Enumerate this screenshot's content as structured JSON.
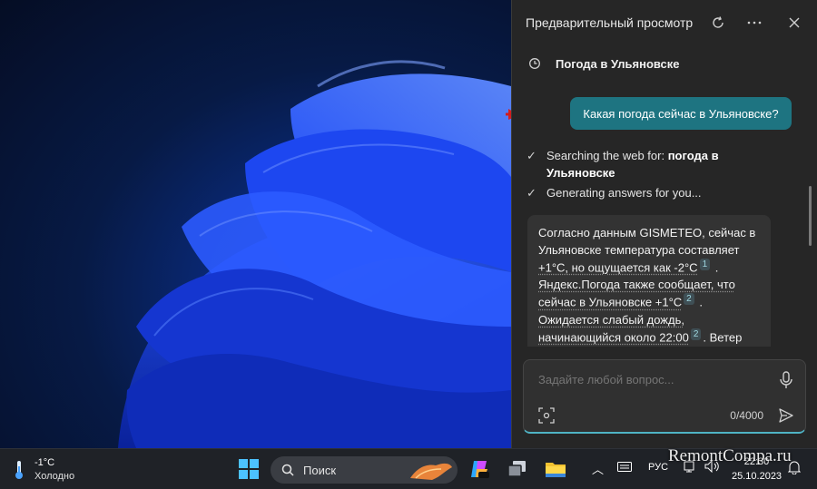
{
  "panel": {
    "title": "Предварительный просмотр",
    "conversation_title": "Погода в Ульяновске",
    "user_message": "Какая погода сейчас в Ульяновске?",
    "steps": [
      {
        "prefix": "Searching the web for: ",
        "bold": "погода в Ульяновске"
      },
      {
        "prefix": "Generating answers for you...",
        "bold": ""
      }
    ],
    "answer": {
      "line1": "Согласно данным GISMETEO, сейчас в",
      "line2": "Ульяновске температура составляет",
      "line3": "+1°C, но ощущается как -2°C",
      "cite1": "1",
      "line4": "Яндекс.Погода также сообщает, что",
      "line5": "сейчас в Ульяновске +1°C",
      "cite2": "2",
      "line6": "Ожидается слабый дождь,",
      "line7": "начинающийся около 22:00",
      "cite3": "2",
      "line7_tail": ". Ветер"
    },
    "input": {
      "placeholder": "Задайте любой вопрос...",
      "counter": "0/4000"
    },
    "accent_color": "#1e7481"
  },
  "taskbar": {
    "weather_temp": "-1°C",
    "weather_desc": "Холодно",
    "search_label": "Поиск",
    "language": "РУС",
    "time": "22:30",
    "date": "25.10.2023"
  },
  "watermark": "RemontCompa.ru"
}
